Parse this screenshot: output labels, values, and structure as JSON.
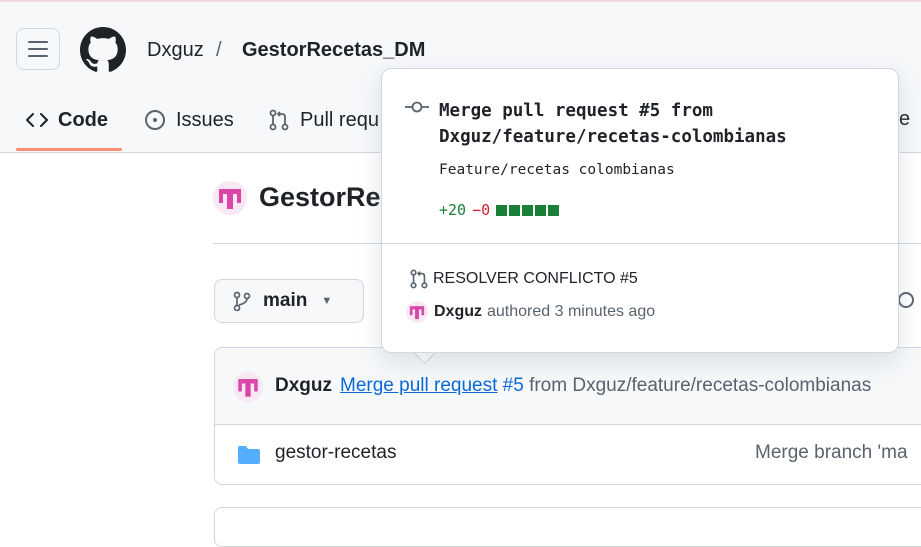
{
  "breadcrumb": {
    "owner": "Dxguz",
    "separator": "/",
    "repo": "GestorRecetas_DM"
  },
  "tabs": [
    {
      "label": "Code",
      "icon": "code-icon"
    },
    {
      "label": "Issues",
      "icon": "issue-opened-icon"
    },
    {
      "label": "Pull requ",
      "icon": "git-pull-request-icon"
    }
  ],
  "tab_fragment": "e",
  "repo": {
    "title": "GestorRe"
  },
  "branch": {
    "name": "main"
  },
  "commit": {
    "author": "Dxguz",
    "link_text": "Merge pull request",
    "pr_ref": "#5",
    "rest": " from Dxguz/feature/recetas-colombianas"
  },
  "files": [
    {
      "name": "gestor-recetas",
      "message": "Merge branch 'ma",
      "icon": "folder-icon"
    }
  ],
  "popover": {
    "title": "Merge pull request #5 from Dxguz/feature/recetas-colombianas",
    "description": "Feature/recetas colombianas",
    "additions": "+20",
    "deletions": "−0",
    "diff_blocks_added": 5,
    "pr_title": "RESOLVER CONFLICTO #5",
    "author": "Dxguz",
    "meta": "authored 3 minutes ago"
  },
  "colors": {
    "accent_underline": "#fd8c73",
    "link": "#0969da",
    "add": "#1a7f37",
    "delete": "#cf222e",
    "avatar": "#d946a8"
  }
}
